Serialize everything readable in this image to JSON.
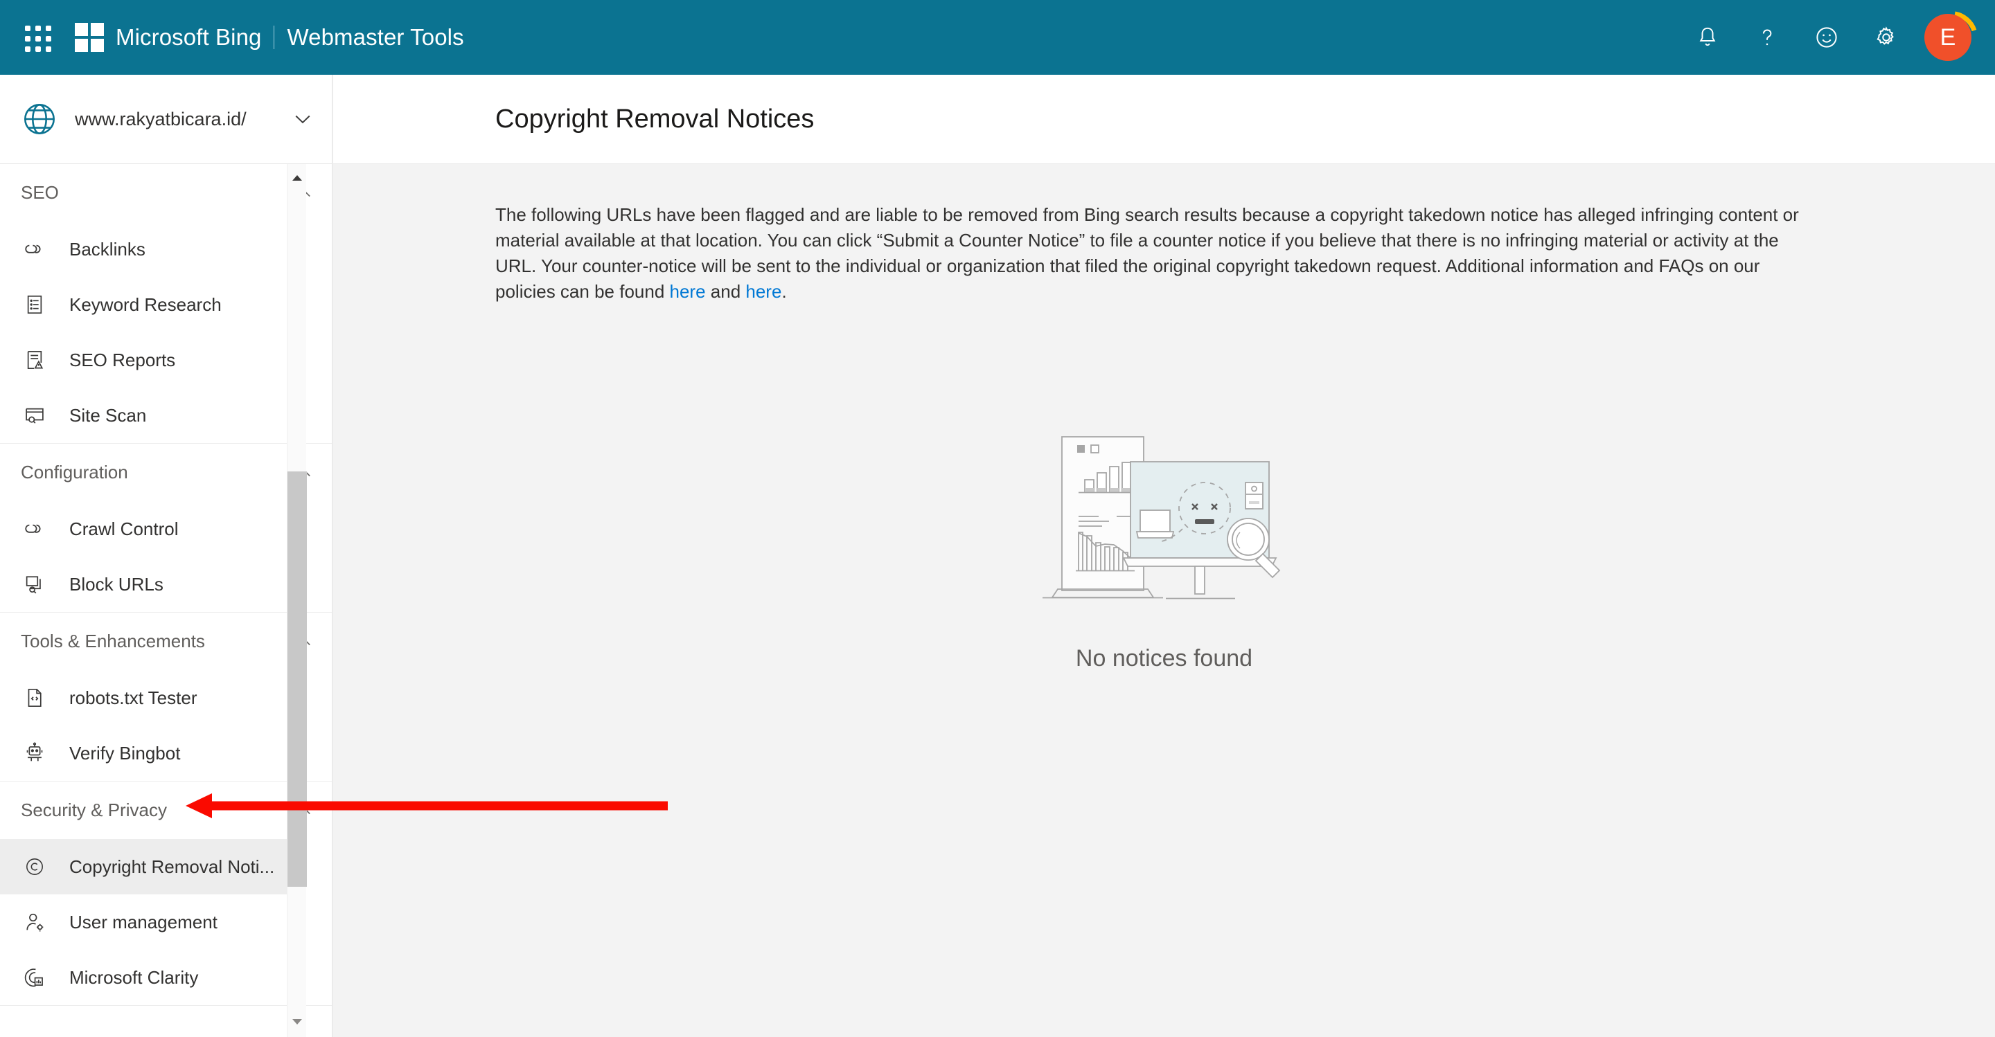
{
  "header": {
    "waffle_label": "app-launcher",
    "brand": "Microsoft Bing",
    "brand_separator": "|",
    "product": "Webmaster Tools",
    "icons": [
      {
        "name": "notifications-icon",
        "glyph": "bell"
      },
      {
        "name": "help-icon",
        "glyph": "question-mark"
      },
      {
        "name": "feedback-icon",
        "glyph": "smiley"
      },
      {
        "name": "settings-icon",
        "glyph": "gear"
      }
    ],
    "avatar_initial": "E",
    "avatar_color": "#f0502a",
    "bar_color": "#0b7391"
  },
  "sidebar": {
    "site": {
      "url": "www.rakyatbicara.id/",
      "icon": "globe-icon",
      "chevron": "chevron-down-icon"
    },
    "sections": [
      {
        "id": "seo",
        "title": "SEO",
        "expanded": true,
        "chevron": "chevron-up-icon",
        "items": [
          {
            "label": "Backlinks",
            "icon": "link-icon",
            "selected": false
          },
          {
            "label": "Keyword Research",
            "icon": "document-list-icon",
            "selected": false
          },
          {
            "label": "SEO Reports",
            "icon": "report-warning-icon",
            "selected": false
          },
          {
            "label": "Site Scan",
            "icon": "window-search-icon",
            "selected": false
          }
        ]
      },
      {
        "id": "configuration",
        "title": "Configuration",
        "expanded": true,
        "chevron": "chevron-up-icon",
        "items": [
          {
            "label": "Crawl Control",
            "icon": "link-icon",
            "selected": false
          },
          {
            "label": "Block URLs",
            "icon": "windows-search-icon",
            "selected": false
          }
        ]
      },
      {
        "id": "tools",
        "title": "Tools & Enhancements",
        "expanded": true,
        "chevron": "chevron-up-icon",
        "items": [
          {
            "label": "robots.txt Tester",
            "icon": "code-file-icon",
            "selected": false
          },
          {
            "label": "Verify Bingbot",
            "icon": "robot-icon",
            "selected": false
          }
        ]
      },
      {
        "id": "security",
        "title": "Security & Privacy",
        "expanded": true,
        "chevron": "chevron-up-icon",
        "items": [
          {
            "label": "Copyright Removal Noti...",
            "icon": "copyright-icon",
            "selected": true
          },
          {
            "label": "User management",
            "icon": "user-settings-icon",
            "selected": false
          },
          {
            "label": "Microsoft Clarity",
            "icon": "clarity-icon",
            "selected": false
          }
        ]
      }
    ],
    "scrollbar": {
      "up_arrow": "scroll-up-arrow",
      "down_arrow": "scroll-down-arrow",
      "thumb_color": "#c8c8c8"
    }
  },
  "main": {
    "title": "Copyright Removal Notices",
    "intro": {
      "part1": "The following URLs have been flagged and are liable to be removed from Bing search results because a copyright takedown notice has alleged infringing content or material available at that location. You can click “Submit a Counter Notice” to file a counter notice if you believe that there is no infringing material or activity at the URL. Your counter-notice will be sent to the individual or organization that filed the original copyright takedown request. Additional information and FAQs on our policies can be found ",
      "link1": "here",
      "mid": " and ",
      "link2": "here",
      "end": "."
    },
    "empty_state": {
      "illustration": "no-data-illustration",
      "message": "No notices found"
    }
  },
  "annotation": {
    "arrow": "red-annotation-arrow",
    "color": "#fa0a00",
    "points_to": "Security & Privacy"
  }
}
